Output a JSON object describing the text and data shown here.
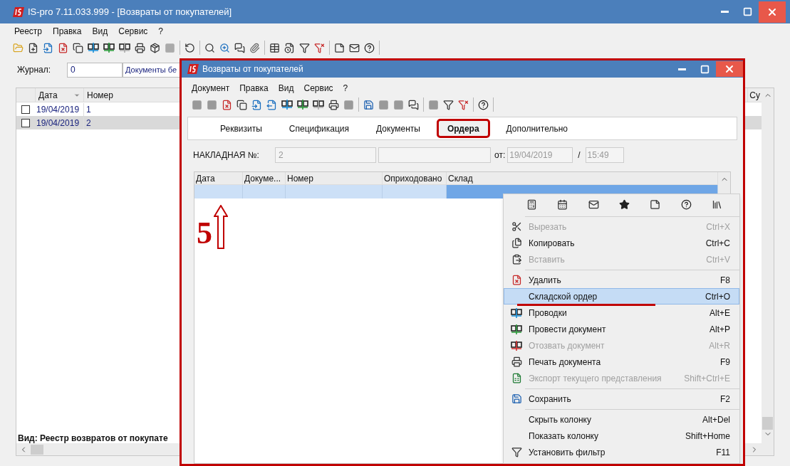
{
  "main_window": {
    "title": "IS-pro 7.11.033.999 - [Возвраты от покупателей]",
    "menu": [
      "Реестр",
      "Правка",
      "Вид",
      "Сервис",
      "?"
    ],
    "journal": {
      "label": "Журнал:",
      "number": "0",
      "name": "Документы бе"
    },
    "table": {
      "columns": [
        "Дата",
        "Номер",
        "Су"
      ],
      "rows": [
        {
          "date": "19/04/2019",
          "number": "1",
          "checked": false,
          "selected": false
        },
        {
          "date": "19/04/2019",
          "number": "2",
          "checked": false,
          "selected": true
        }
      ]
    },
    "status": "Вид: Реестр возвратов от покупате"
  },
  "dialog": {
    "title": "Возвраты от покупателей",
    "menu": [
      "Документ",
      "Правка",
      "Вид",
      "Сервис",
      "?"
    ],
    "tabs": [
      {
        "label": "Реквизиты",
        "selected": false
      },
      {
        "label": "Спецификация",
        "selected": false
      },
      {
        "label": "Документы",
        "selected": false
      },
      {
        "label": "Ордера",
        "selected": true
      },
      {
        "label": "Дополнительно",
        "selected": false
      }
    ],
    "invoice": {
      "label": "НАКЛАДНАЯ №:",
      "number": "2",
      "date_label": "от:",
      "date": "19/04/2019",
      "separator": "/",
      "time": "15:49"
    },
    "table": {
      "columns": [
        "Дата",
        "Докуме...",
        "Номер",
        "Оприходовано",
        "Склад"
      ],
      "rows": [
        {
          "selected": true
        }
      ]
    }
  },
  "context_menu": {
    "sections": [
      [
        {
          "label": "Вырезать",
          "shortcut": "Ctrl+X",
          "disabled": true,
          "selected": false
        },
        {
          "label": "Копировать",
          "shortcut": "Ctrl+C",
          "disabled": false,
          "selected": false
        },
        {
          "label": "Вставить",
          "shortcut": "Ctrl+V",
          "disabled": true,
          "selected": false
        }
      ],
      [
        {
          "label": "Удалить",
          "shortcut": "F8",
          "disabled": false,
          "selected": false
        },
        {
          "label": "Складской ордер",
          "shortcut": "Ctrl+O",
          "disabled": false,
          "selected": true
        },
        {
          "label": "Проводки",
          "shortcut": "Alt+E",
          "disabled": false,
          "selected": false
        },
        {
          "label": "Провести документ",
          "shortcut": "Alt+P",
          "disabled": false,
          "selected": false
        },
        {
          "label": "Отозвать документ",
          "shortcut": "Alt+R",
          "disabled": true,
          "selected": false
        },
        {
          "label": "Печать документа",
          "shortcut": "F9",
          "disabled": false,
          "selected": false
        },
        {
          "label": "Экспорт текущего представления",
          "shortcut": "Shift+Ctrl+E",
          "disabled": true,
          "selected": false
        }
      ],
      [
        {
          "label": "Сохранить",
          "shortcut": "F2",
          "disabled": false,
          "selected": false
        }
      ],
      [
        {
          "label": "Скрыть колонку",
          "shortcut": "Alt+Del",
          "disabled": false,
          "selected": false
        },
        {
          "label": "Показать колонку",
          "shortcut": "Shift+Home",
          "disabled": false,
          "selected": false
        },
        {
          "label": "Установить фильтр",
          "shortcut": "F11",
          "disabled": false,
          "selected": false
        }
      ]
    ]
  },
  "annotation": {
    "step": "5"
  }
}
